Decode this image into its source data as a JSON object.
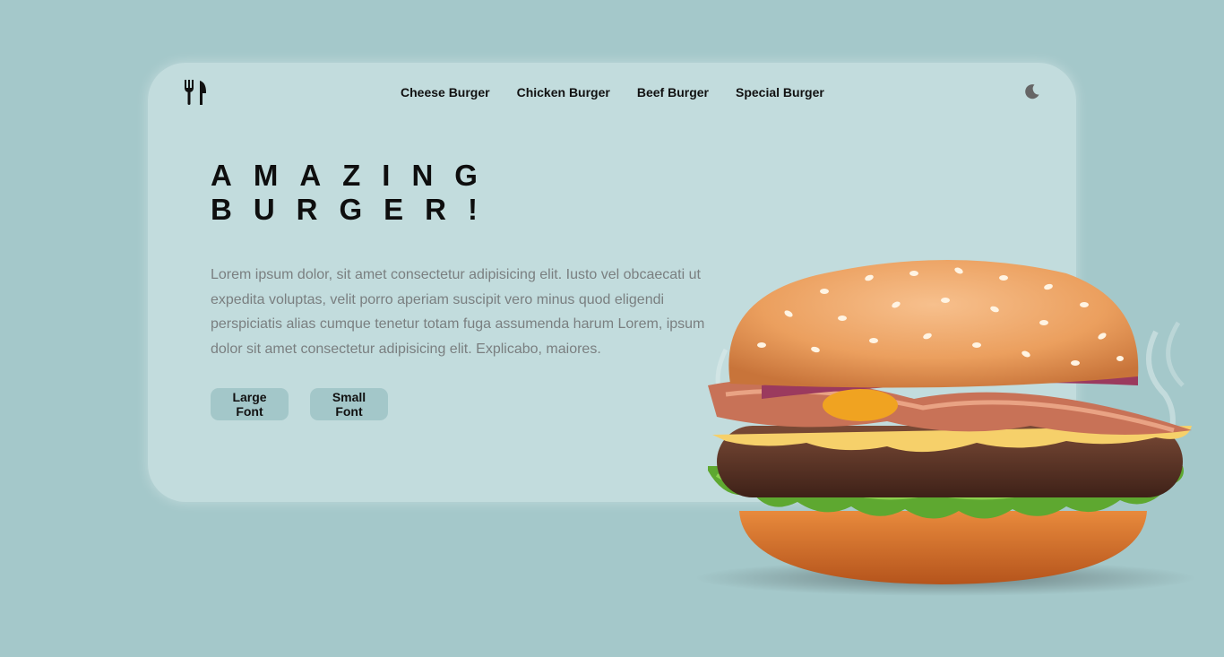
{
  "nav": {
    "logo_icon": "fork-knife-icon",
    "items": [
      {
        "label": "Cheese Burger"
      },
      {
        "label": "Chicken Burger"
      },
      {
        "label": "Beef Burger"
      },
      {
        "label": "Special Burger"
      }
    ],
    "theme_icon": "moon-icon"
  },
  "hero": {
    "title_line1": "AMAZING",
    "title_line2": "BURGER!",
    "description": "Lorem ipsum dolor, sit amet consectetur adipisicing elit. Iusto vel obcaecati ut expedita voluptas, velit porro aperiam suscipit vero minus quod eligendi perspiciatis alias cumque tenetur totam fuga assumenda harum Lorem, ipsum dolor sit amet consectetur adipisicing elit. Explicabo, maiores.",
    "buttons": {
      "large_font": "Large Font",
      "small_font": "Small Font"
    },
    "image": "burger-image"
  },
  "colors": {
    "background": "#a4c8ca",
    "card": "#c7dfe0",
    "button": "#a3c7c9",
    "text": "#111111",
    "muted_text": "#7a7f80"
  }
}
